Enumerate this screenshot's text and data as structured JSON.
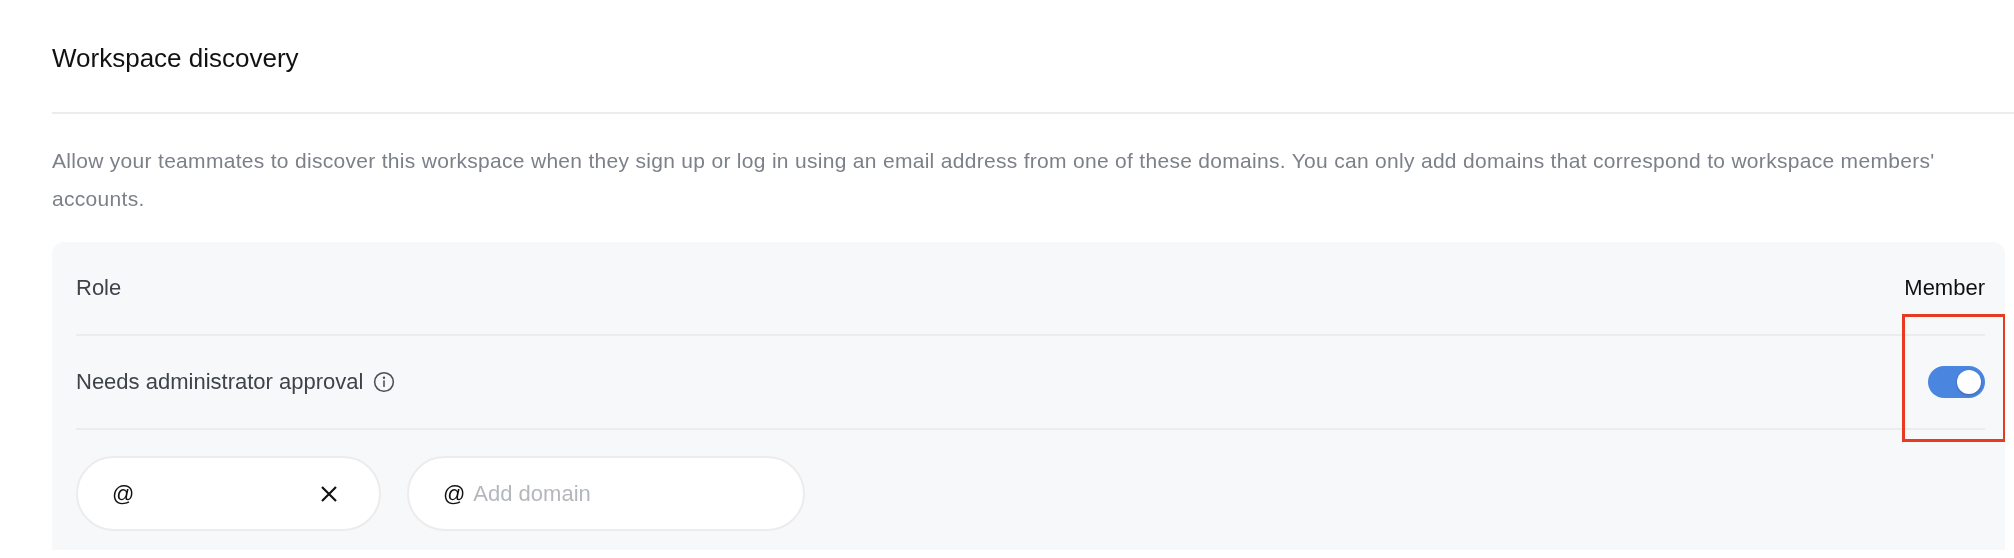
{
  "section": {
    "title": "Workspace discovery",
    "description": "Allow your teammates to discover this workspace when they sign up or log in using an email address from one of these domains. You can only add domains that correspond to workspace members' accounts."
  },
  "settings": [
    {
      "kind": "value",
      "label": "Role",
      "value": "Member"
    },
    {
      "kind": "toggle",
      "label": "Needs administrator approval",
      "info": true,
      "on": true,
      "highlighted": true
    }
  ],
  "domains": [
    {
      "kind": "chip",
      "prefix": "@",
      "removable": true
    },
    {
      "kind": "input",
      "prefix": "@",
      "placeholder": "Add domain"
    }
  ]
}
